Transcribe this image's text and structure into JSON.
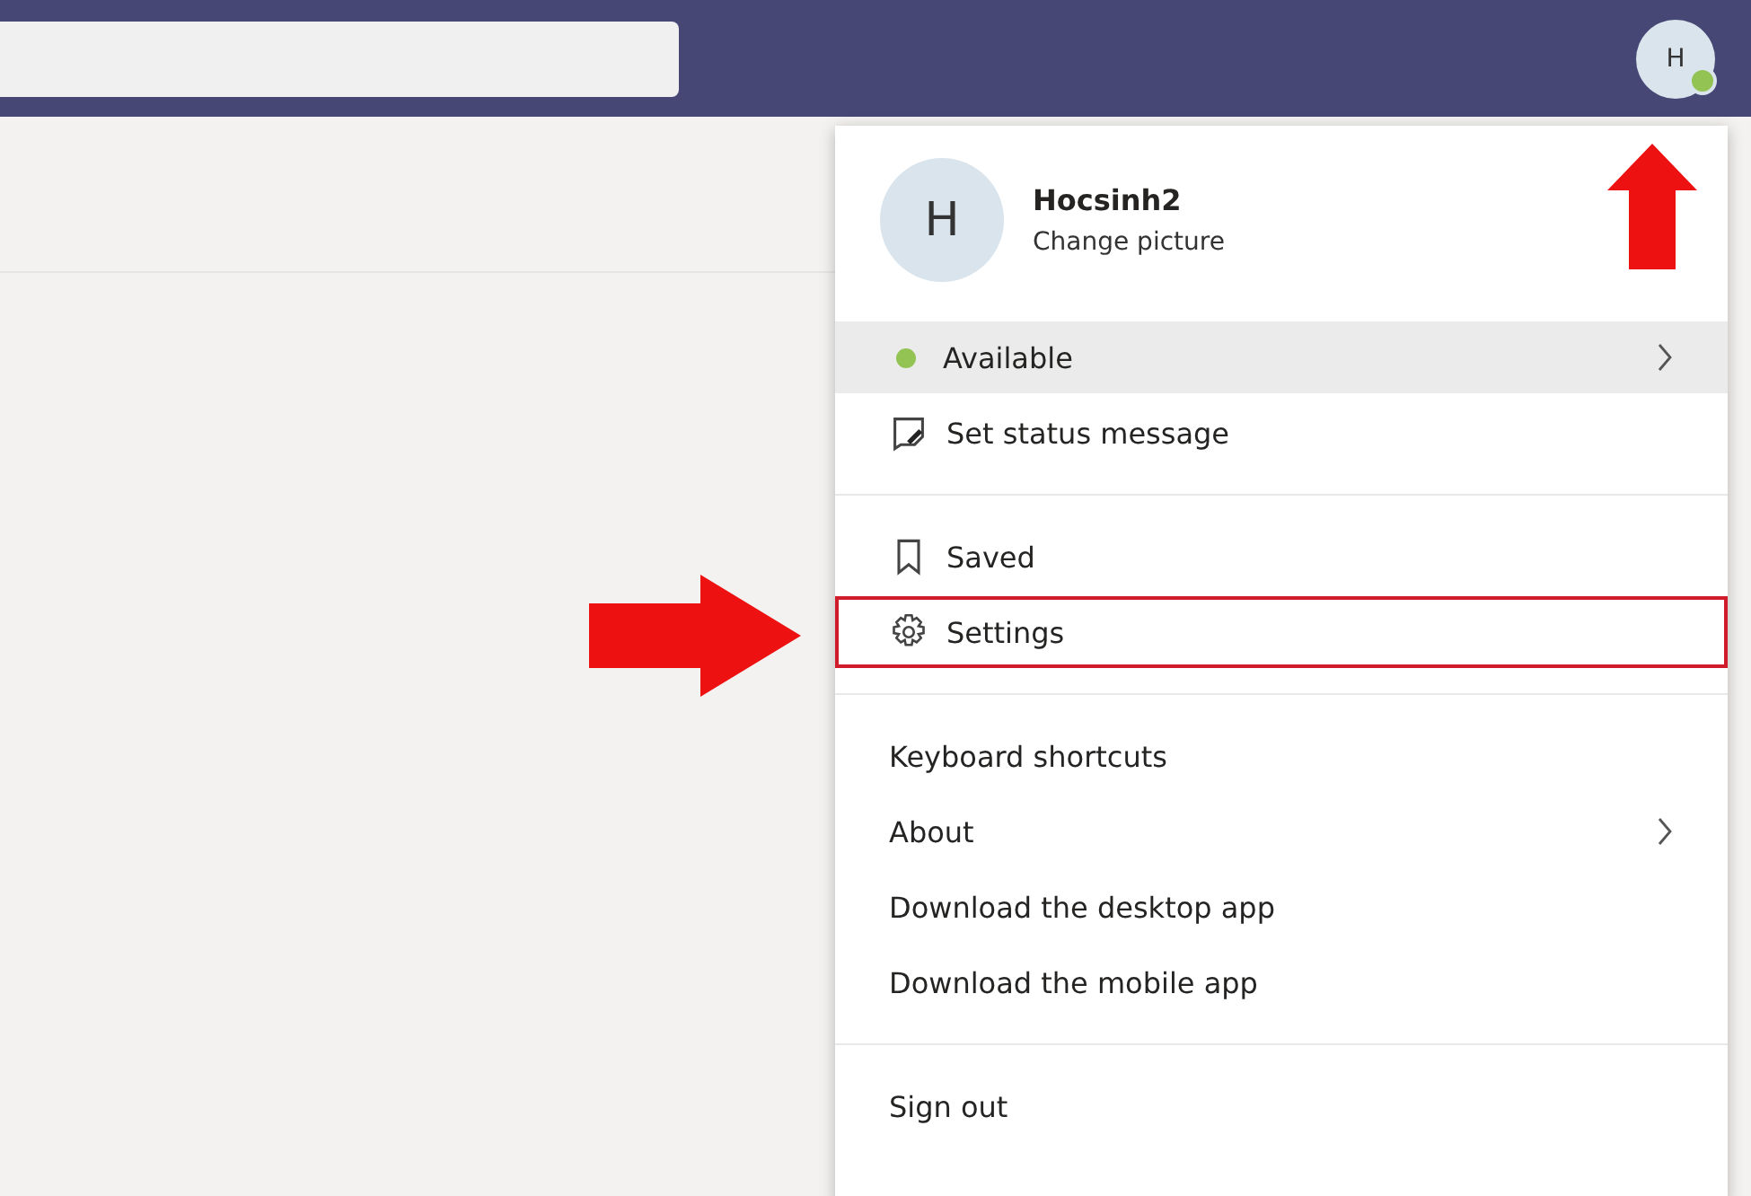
{
  "top_bar": {
    "avatar": {
      "initial": "H",
      "available": true
    }
  },
  "profile_menu": {
    "avatar_initial": "H",
    "name": "Hocsinh2",
    "subtitle": "Change picture",
    "sections": [
      [
        {
          "kind": "status",
          "label": "Available",
          "color": "#92c353",
          "selected": true,
          "submenu": true,
          "highlighted": false
        },
        {
          "kind": "status-message",
          "label": "Set status message",
          "selected": false,
          "submenu": false,
          "highlighted": false
        }
      ],
      [
        {
          "kind": "saved",
          "label": "Saved",
          "selected": false,
          "submenu": false,
          "highlighted": false
        },
        {
          "kind": "settings",
          "label": "Settings",
          "selected": false,
          "submenu": false,
          "highlighted": true
        }
      ],
      [
        {
          "kind": "plain",
          "label": "Keyboard shortcuts",
          "selected": false,
          "submenu": false,
          "highlighted": false
        },
        {
          "kind": "plain",
          "label": "About",
          "selected": false,
          "submenu": true,
          "highlighted": false
        },
        {
          "kind": "plain",
          "label": "Download the desktop app",
          "selected": false,
          "submenu": false,
          "highlighted": false
        },
        {
          "kind": "plain",
          "label": "Download the mobile app",
          "selected": false,
          "submenu": false,
          "highlighted": false
        }
      ],
      [
        {
          "kind": "plain",
          "label": "Sign out",
          "selected": false,
          "submenu": false,
          "highlighted": false
        }
      ]
    ]
  }
}
